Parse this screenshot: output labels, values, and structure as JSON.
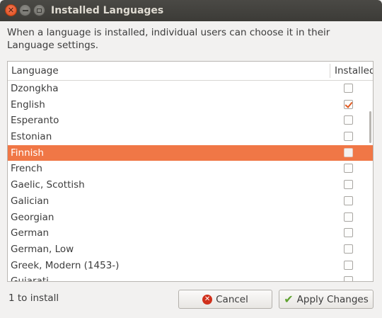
{
  "window": {
    "title": "Installed Languages"
  },
  "description": "When a language is installed, individual users can choose it in their Language settings.",
  "list": {
    "columns": {
      "language": "Language",
      "installed": "Installed"
    },
    "rows": [
      {
        "name": "Dzongkha",
        "installed": false,
        "selected": false
      },
      {
        "name": "English",
        "installed": true,
        "selected": false
      },
      {
        "name": "Esperanto",
        "installed": false,
        "selected": false
      },
      {
        "name": "Estonian",
        "installed": false,
        "selected": false
      },
      {
        "name": "Finnish",
        "installed": false,
        "selected": true
      },
      {
        "name": "French",
        "installed": false,
        "selected": false
      },
      {
        "name": "Gaelic, Scottish",
        "installed": false,
        "selected": false
      },
      {
        "name": "Galician",
        "installed": false,
        "selected": false
      },
      {
        "name": "Georgian",
        "installed": false,
        "selected": false
      },
      {
        "name": "German",
        "installed": false,
        "selected": false
      },
      {
        "name": "German, Low",
        "installed": false,
        "selected": false
      },
      {
        "name": "Greek, Modern (1453-)",
        "installed": false,
        "selected": false
      },
      {
        "name": "Gujarati",
        "installed": false,
        "selected": false
      }
    ]
  },
  "footer": {
    "status": "1 to install",
    "cancel_label": "Cancel",
    "apply_label": "Apply Changes"
  },
  "icons": {
    "close": "close-icon",
    "minimize": "minimize-icon",
    "maximize": "maximize-icon",
    "cancel": "cancel-icon",
    "apply": "checkmark-icon"
  },
  "colors": {
    "selection": "#f07746",
    "titlebar": "#3c3b37",
    "check": "#e05a22"
  }
}
